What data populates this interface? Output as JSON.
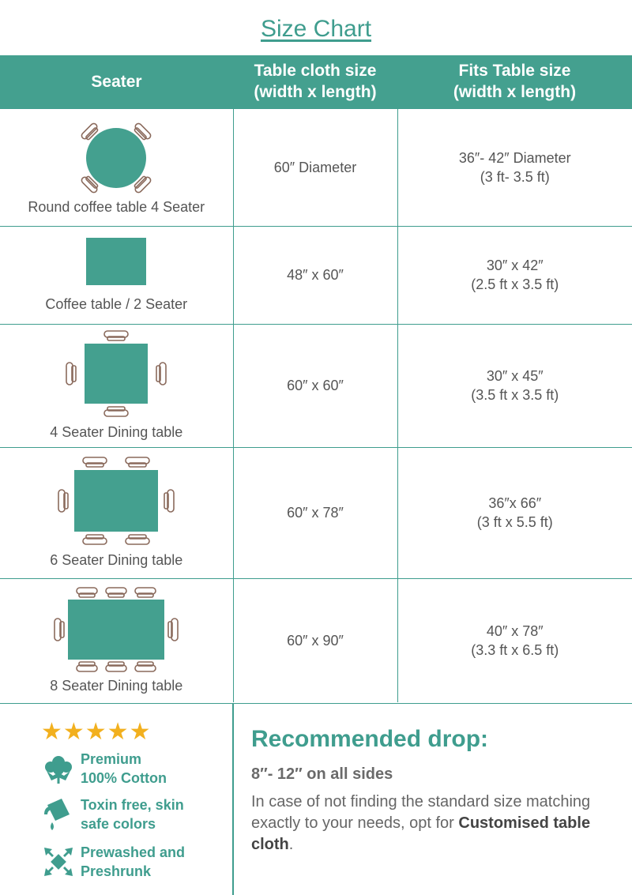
{
  "title": "Size Chart",
  "header": {
    "col1": "Seater",
    "col2_line1": "Table cloth size",
    "col2_line2": "(width x length)",
    "col3_line1": "Fits Table size",
    "col3_line2": "(width x length)"
  },
  "rows": [
    {
      "label": "Round coffee table 4 Seater",
      "cloth": "60″ Diameter",
      "fits_line1": "36″- 42″ Diameter",
      "fits_line2": "(3 ft- 3.5 ft)"
    },
    {
      "label": "Coffee table / 2 Seater",
      "cloth": "48″ x 60″",
      "fits_line1": "30″ x 42″",
      "fits_line2": "(2.5 ft x 3.5 ft)"
    },
    {
      "label": "4 Seater Dining table",
      "cloth": "60″ x 60″",
      "fits_line1": "30″ x 45″",
      "fits_line2": "(3.5 ft x 3.5 ft)"
    },
    {
      "label": "6 Seater Dining table",
      "cloth": "60″ x 78″",
      "fits_line1": "36″x 66″",
      "fits_line2": "(3 ft x 5.5 ft)"
    },
    {
      "label": "8 Seater Dining table",
      "cloth": "60″ x 90″",
      "fits_line1": "40″ x 78″",
      "fits_line2": "(3.3 ft x 6.5 ft)"
    }
  ],
  "rating": {
    "stars": "★★★★★",
    "value": 5,
    "max": 5
  },
  "features": [
    {
      "icon": "cotton-icon",
      "line1": "Premium",
      "line2": "100% Cotton"
    },
    {
      "icon": "paint-bucket-icon",
      "line1": "Toxin free, skin",
      "line2": "safe colors"
    },
    {
      "icon": "shrink-arrows-icon",
      "line1": "Prewashed and",
      "line2": "Preshrunk"
    }
  ],
  "recommended": {
    "heading": "Recommended drop:",
    "drop": "8″- 12″ on all sides",
    "note_text": "In case of not finding the standard size matching exactly to your needs, opt for",
    "note_bold": "Customised table cloth",
    "note_end": "."
  },
  "colors": {
    "accent": "#44a08f",
    "star": "#f2b01e",
    "chair": "#8a6a5c"
  }
}
